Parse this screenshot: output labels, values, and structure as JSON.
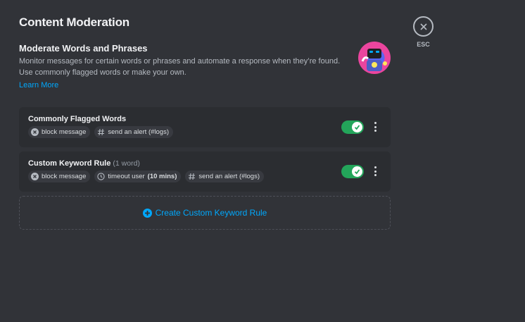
{
  "page": {
    "title": "Content Moderation"
  },
  "intro": {
    "title": "Moderate Words and Phrases",
    "description": "Monitor messages for certain words or phrases and automate a response when they’re found. Use commonly flagged words or make your own.",
    "learn_more": "Learn More",
    "hero_icon": "automod-robot-illustration"
  },
  "rules": [
    {
      "title": "Commonly Flagged Words",
      "subtitle": "",
      "enabled": true,
      "actions": [
        {
          "icon": "block-icon",
          "label": "block message",
          "detail": ""
        },
        {
          "icon": "hashtag-icon",
          "label": "send an alert (#logs)",
          "detail": ""
        }
      ]
    },
    {
      "title": "Custom Keyword Rule",
      "subtitle": "(1 word)",
      "enabled": true,
      "actions": [
        {
          "icon": "block-icon",
          "label": "block message",
          "detail": ""
        },
        {
          "icon": "clock-icon",
          "label": "timeout user",
          "detail": "(10 mins)"
        },
        {
          "icon": "hashtag-icon",
          "label": "send an alert (#logs)",
          "detail": ""
        }
      ]
    }
  ],
  "create": {
    "label": "Create Custom Keyword Rule"
  },
  "close": {
    "label": "ESC"
  },
  "colors": {
    "accent": "#00a8fc",
    "toggle_on": "#23a55a",
    "background": "#313338",
    "card": "#2b2d31"
  }
}
